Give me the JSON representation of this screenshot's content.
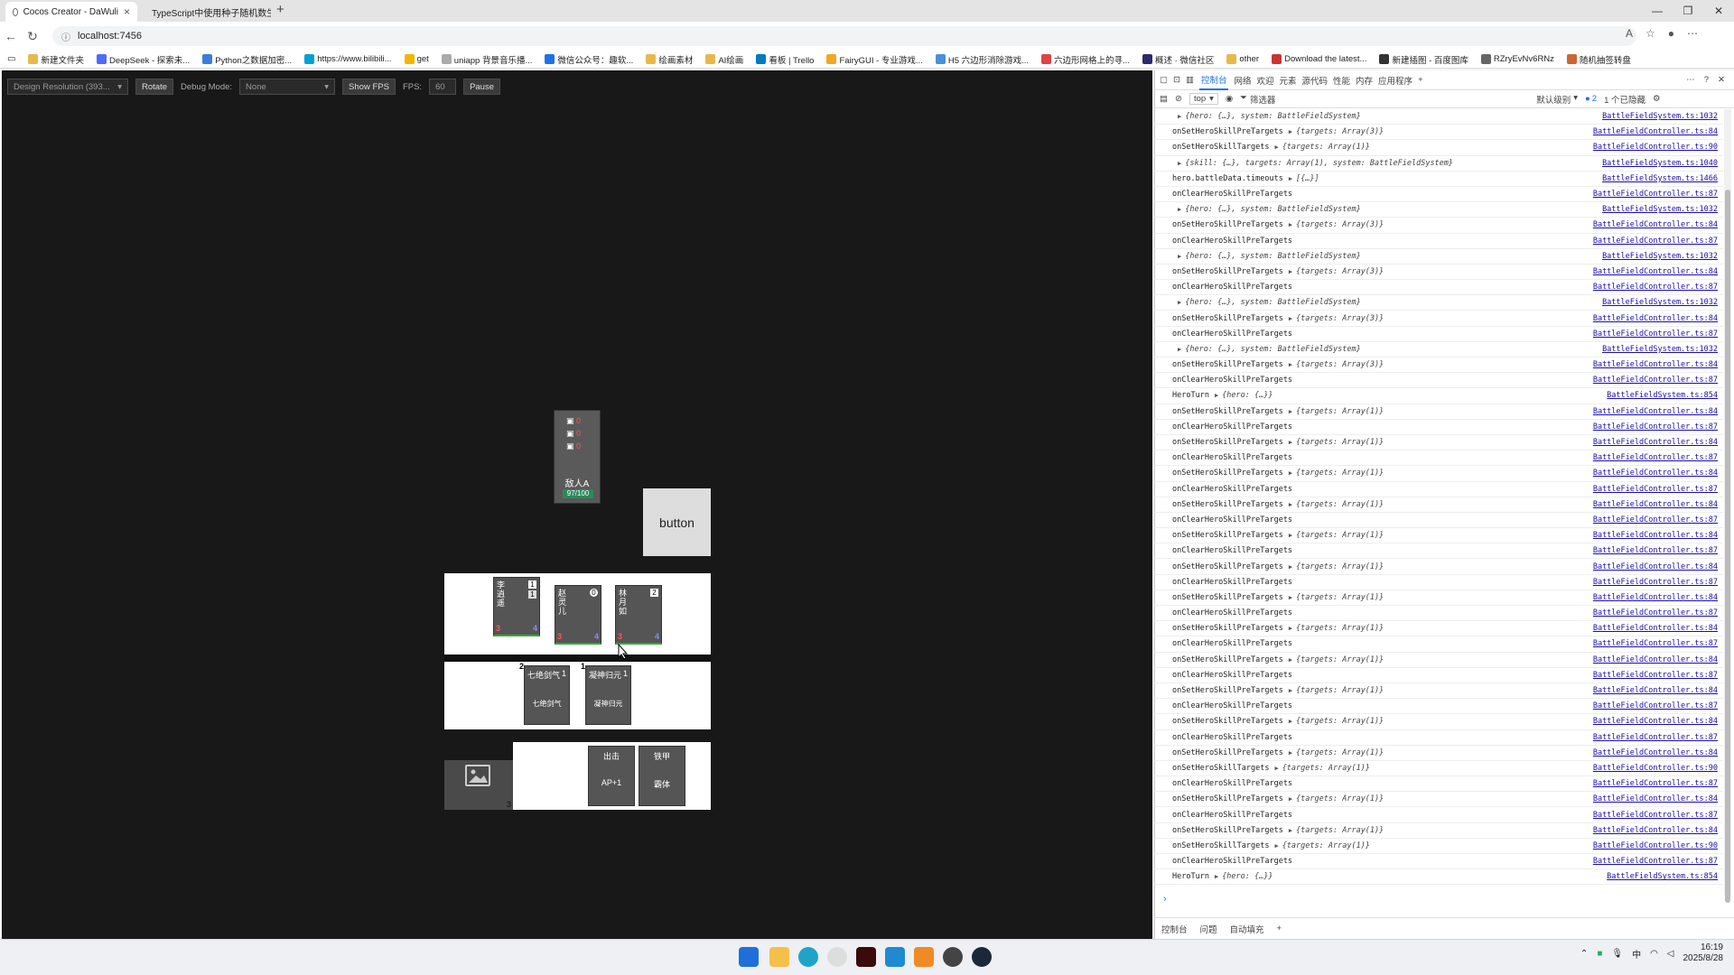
{
  "browser": {
    "tabs": [
      {
        "title": "Cocos Creator - DaWuli",
        "active": true
      },
      {
        "title": "TypeScript中使用种子随机数生成",
        "active": false
      }
    ],
    "new_tab": "+",
    "url": "localhost:7456",
    "bookmarks": [
      "新建文件夹",
      "DeepSeek - 探索未...",
      "Python之数据加密...",
      "https://www.bilibili...",
      "get",
      "uniapp 背景音乐播...",
      "微信公众号：趣软...",
      "绘画素材",
      "AI绘画",
      "看板 | Trello",
      "FairyGUI - 专业游戏...",
      "H5 六边形消除游戏...",
      "六边形网格上的寻...",
      "概述 · 微信社区",
      "other",
      "Download the latest...",
      "新建插图 - 百度图库",
      "RZryEvNv6RNz",
      "随机抽签转盘"
    ]
  },
  "game_toolbar": {
    "design_resolution": "Design Resolution (393...",
    "rotate": "Rotate",
    "debug_label": "Debug Mode:",
    "debug_value": "None",
    "show_fps": "Show FPS",
    "fps_label": "FPS:",
    "fps_value": "60",
    "pause": "Pause"
  },
  "game": {
    "enemy": {
      "name": "敌人A",
      "hp": "97/100",
      "buffs": [
        "0",
        "0",
        "0"
      ]
    },
    "button_label": "button",
    "heroes": [
      {
        "name": "李\n逍\n遥",
        "top": "1",
        "top2": "1",
        "bl": "3",
        "br": "4"
      },
      {
        "name": "赵\n灵\n儿",
        "top": "0",
        "bl": "3",
        "br": "4"
      },
      {
        "name": "林\n月\n如",
        "top": "2",
        "bl": "3",
        "br": "4"
      }
    ],
    "skills": [
      {
        "title": "七绝剑气",
        "cost": "1",
        "left": "2",
        "desc": "七绝剑气"
      },
      {
        "title": "凝神归元",
        "cost": "1",
        "left": "1",
        "desc": "凝神归元"
      }
    ],
    "deck_count": "3",
    "actions": [
      {
        "title": "出击",
        "desc": "AP+1"
      },
      {
        "title": "铁甲",
        "desc": "霸体"
      }
    ]
  },
  "devtools": {
    "tabs": [
      "控制台",
      "网络",
      "欢迎",
      "元素",
      "源代码",
      "性能",
      "内存",
      "应用程序"
    ],
    "context": "top",
    "filter": "筛选器",
    "level": "默认级别",
    "issues": "2",
    "hidden": "1 个已隐藏",
    "logs": [
      {
        "msg": "",
        "obj": "{hero: {…}, system: BattleFieldSystem}",
        "src": "BattleFieldSystem.ts:1032",
        "expand": true
      },
      {
        "msg": "onSetHeroSkillPreTargets",
        "obj": "{targets: Array(3)}",
        "src": "BattleFieldController.ts:84",
        "expand": true
      },
      {
        "msg": "onSetHeroSkillTargets",
        "obj": "{targets: Array(1)}",
        "src": "BattleFieldController.ts:90",
        "expand": true
      },
      {
        "msg": "",
        "obj": "{skill: {…}, targets: Array(1), system: BattleFieldSystem}",
        "src": "BattleFieldSystem.ts:1040",
        "expand": true
      },
      {
        "msg": "hero.battleData.timeouts",
        "obj": "[{…}]",
        "src": "BattleFieldSystem.ts:1466",
        "expand": true
      },
      {
        "msg": "onClearHeroSkillPreTargets",
        "obj": "",
        "src": "BattleFieldController.ts:87",
        "expand": false
      },
      {
        "msg": "",
        "obj": "{hero: {…}, system: BattleFieldSystem}",
        "src": "BattleFieldSystem.ts:1032",
        "expand": true
      },
      {
        "msg": "onSetHeroSkillPreTargets",
        "obj": "{targets: Array(3)}",
        "src": "BattleFieldController.ts:84",
        "expand": true
      },
      {
        "msg": "onClearHeroSkillPreTargets",
        "obj": "",
        "src": "BattleFieldController.ts:87",
        "expand": false
      },
      {
        "msg": "",
        "obj": "{hero: {…}, system: BattleFieldSystem}",
        "src": "BattleFieldSystem.ts:1032",
        "expand": true
      },
      {
        "msg": "onSetHeroSkillPreTargets",
        "obj": "{targets: Array(3)}",
        "src": "BattleFieldController.ts:84",
        "expand": true
      },
      {
        "msg": "onClearHeroSkillPreTargets",
        "obj": "",
        "src": "BattleFieldController.ts:87",
        "expand": false
      },
      {
        "msg": "",
        "obj": "{hero: {…}, system: BattleFieldSystem}",
        "src": "BattleFieldSystem.ts:1032",
        "expand": true
      },
      {
        "msg": "onSetHeroSkillPreTargets",
        "obj": "{targets: Array(3)}",
        "src": "BattleFieldController.ts:84",
        "expand": true
      },
      {
        "msg": "onClearHeroSkillPreTargets",
        "obj": "",
        "src": "BattleFieldController.ts:87",
        "expand": false
      },
      {
        "msg": "",
        "obj": "{hero: {…}, system: BattleFieldSystem}",
        "src": "BattleFieldSystem.ts:1032",
        "expand": true
      },
      {
        "msg": "onSetHeroSkillPreTargets",
        "obj": "{targets: Array(3)}",
        "src": "BattleFieldController.ts:84",
        "expand": true
      },
      {
        "msg": "onClearHeroSkillPreTargets",
        "obj": "",
        "src": "BattleFieldController.ts:87",
        "expand": false
      },
      {
        "msg": "HeroTurn",
        "obj": "{hero: {…}}",
        "src": "BattleFieldSystem.ts:854",
        "expand": true
      },
      {
        "msg": "onSetHeroSkillPreTargets",
        "obj": "{targets: Array(1)}",
        "src": "BattleFieldController.ts:84",
        "expand": true
      },
      {
        "msg": "onClearHeroSkillPreTargets",
        "obj": "",
        "src": "BattleFieldController.ts:87",
        "expand": false
      },
      {
        "msg": "onSetHeroSkillPreTargets",
        "obj": "{targets: Array(1)}",
        "src": "BattleFieldController.ts:84",
        "expand": true
      },
      {
        "msg": "onClearHeroSkillPreTargets",
        "obj": "",
        "src": "BattleFieldController.ts:87",
        "expand": false
      },
      {
        "msg": "onSetHeroSkillPreTargets",
        "obj": "{targets: Array(1)}",
        "src": "BattleFieldController.ts:84",
        "expand": true
      },
      {
        "msg": "onClearHeroSkillPreTargets",
        "obj": "",
        "src": "BattleFieldController.ts:87",
        "expand": false
      },
      {
        "msg": "onSetHeroSkillPreTargets",
        "obj": "{targets: Array(1)}",
        "src": "BattleFieldController.ts:84",
        "expand": true
      },
      {
        "msg": "onClearHeroSkillPreTargets",
        "obj": "",
        "src": "BattleFieldController.ts:87",
        "expand": false
      },
      {
        "msg": "onSetHeroSkillPreTargets",
        "obj": "{targets: Array(1)}",
        "src": "BattleFieldController.ts:84",
        "expand": true
      },
      {
        "msg": "onClearHeroSkillPreTargets",
        "obj": "",
        "src": "BattleFieldController.ts:87",
        "expand": false
      },
      {
        "msg": "onSetHeroSkillPreTargets",
        "obj": "{targets: Array(1)}",
        "src": "BattleFieldController.ts:84",
        "expand": true
      },
      {
        "msg": "onClearHeroSkillPreTargets",
        "obj": "",
        "src": "BattleFieldController.ts:87",
        "expand": false
      },
      {
        "msg": "onSetHeroSkillPreTargets",
        "obj": "{targets: Array(1)}",
        "src": "BattleFieldController.ts:84",
        "expand": true
      },
      {
        "msg": "onClearHeroSkillPreTargets",
        "obj": "",
        "src": "BattleFieldController.ts:87",
        "expand": false
      },
      {
        "msg": "onSetHeroSkillPreTargets",
        "obj": "{targets: Array(1)}",
        "src": "BattleFieldController.ts:84",
        "expand": true
      },
      {
        "msg": "onClearHeroSkillPreTargets",
        "obj": "",
        "src": "BattleFieldController.ts:87",
        "expand": false
      },
      {
        "msg": "onSetHeroSkillPreTargets",
        "obj": "{targets: Array(1)}",
        "src": "BattleFieldController.ts:84",
        "expand": true
      },
      {
        "msg": "onClearHeroSkillPreTargets",
        "obj": "",
        "src": "BattleFieldController.ts:87",
        "expand": false
      },
      {
        "msg": "onSetHeroSkillPreTargets",
        "obj": "{targets: Array(1)}",
        "src": "BattleFieldController.ts:84",
        "expand": true
      },
      {
        "msg": "onClearHeroSkillPreTargets",
        "obj": "",
        "src": "BattleFieldController.ts:87",
        "expand": false
      },
      {
        "msg": "onSetHeroSkillPreTargets",
        "obj": "{targets: Array(1)}",
        "src": "BattleFieldController.ts:84",
        "expand": true
      },
      {
        "msg": "onClearHeroSkillPreTargets",
        "obj": "",
        "src": "BattleFieldController.ts:87",
        "expand": false
      },
      {
        "msg": "onSetHeroSkillPreTargets",
        "obj": "{targets: Array(1)}",
        "src": "BattleFieldController.ts:84",
        "expand": true
      },
      {
        "msg": "onSetHeroSkillTargets",
        "obj": "{targets: Array(1)}",
        "src": "BattleFieldController.ts:90",
        "expand": true
      },
      {
        "msg": "onClearHeroSkillPreTargets",
        "obj": "",
        "src": "BattleFieldController.ts:87",
        "expand": false
      },
      {
        "msg": "onSetHeroSkillPreTargets",
        "obj": "{targets: Array(1)}",
        "src": "BattleFieldController.ts:84",
        "expand": true
      },
      {
        "msg": "onClearHeroSkillPreTargets",
        "obj": "",
        "src": "BattleFieldController.ts:87",
        "expand": false
      },
      {
        "msg": "onSetHeroSkillPreTargets",
        "obj": "{targets: Array(1)}",
        "src": "BattleFieldController.ts:84",
        "expand": true
      },
      {
        "msg": "onSetHeroSkillTargets",
        "obj": "{targets: Array(1)}",
        "src": "BattleFieldController.ts:90",
        "expand": true
      },
      {
        "msg": "onClearHeroSkillPreTargets",
        "obj": "",
        "src": "BattleFieldController.ts:87",
        "expand": false
      },
      {
        "msg": "HeroTurn",
        "obj": "{hero: {…}}",
        "src": "BattleFieldSystem.ts:854",
        "expand": true
      }
    ],
    "bottom_tabs": [
      "控制台",
      "问题",
      "自动填充"
    ]
  },
  "taskbar": {
    "time": "16:19",
    "date": "2025/8/28",
    "ime": "中"
  }
}
